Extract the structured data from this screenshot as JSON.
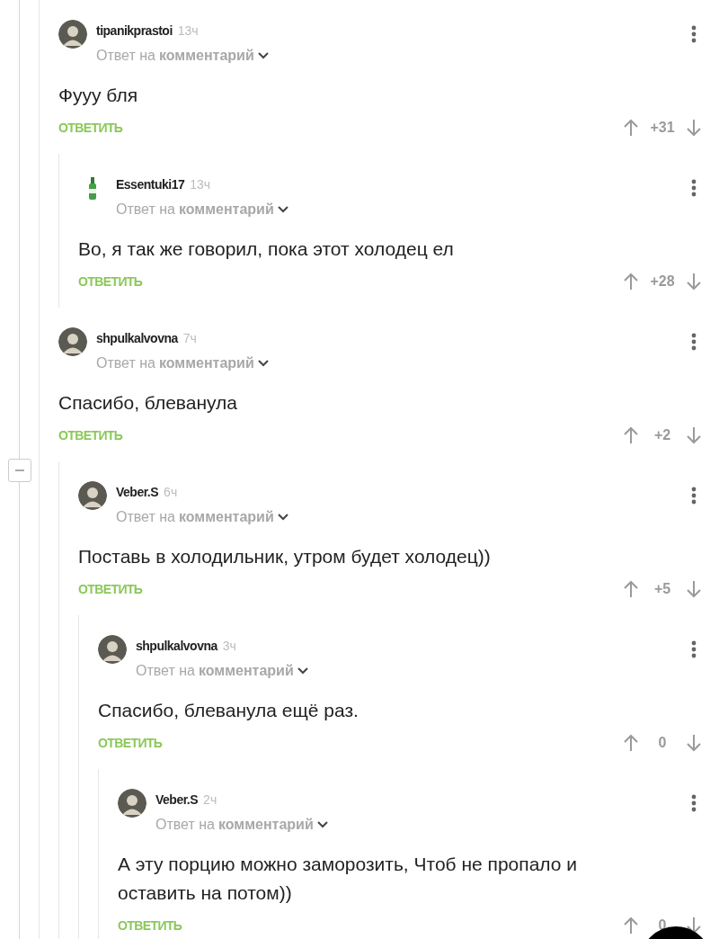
{
  "comments": [
    {
      "author": "tipanikprastoi",
      "time": "13ч",
      "avatar": {
        "kind": "photo"
      },
      "reply_to_prefix": "Ответ на",
      "reply_to": "комментарий",
      "text": "Фууу бля",
      "reply_label": "ОТВЕТИТЬ",
      "score": "+31",
      "children": [
        {
          "author": "Essentuki17",
          "time": "13ч",
          "avatar": {
            "kind": "bottle"
          },
          "reply_to_prefix": "Ответ на",
          "reply_to": "комментарий",
          "text": "Во, я так же говорил, пока этот холодец ел",
          "reply_label": "ОТВЕТИТЬ",
          "score": "+28"
        }
      ]
    },
    {
      "author": "shpulkalvovna",
      "time": "7ч",
      "avatar": {
        "kind": "photo"
      },
      "reply_to_prefix": "Ответ на",
      "reply_to": "комментарий",
      "text": "Спасибо, блеванула",
      "reply_label": "ОТВЕТИТЬ",
      "score": "+2",
      "expanded": true,
      "children": [
        {
          "author": "Veber.S",
          "time": "6ч",
          "avatar": {
            "kind": "photo"
          },
          "reply_to_prefix": "Ответ на",
          "reply_to": "комментарий",
          "text": "Поставь в холодильник, утром будет холодец))",
          "reply_label": "ОТВЕТИТЬ",
          "score": "+5",
          "children": [
            {
              "author": "shpulkalvovna",
              "time": "3ч",
              "avatar": {
                "kind": "photo"
              },
              "reply_to_prefix": "Ответ на",
              "reply_to": "комментарий",
              "text": "Спасибо, блеванула ещё раз.",
              "reply_label": "ОТВЕТИТЬ",
              "score": "0",
              "children": [
                {
                  "author": "Veber.S",
                  "time": "2ч",
                  "avatar": {
                    "kind": "photo"
                  },
                  "reply_to_prefix": "Ответ на",
                  "reply_to": "комментарий",
                  "text": "А эту порцию можно заморозить, Чтоб не пропало и оставить на потом))",
                  "reply_label": "ОТВЕТИТЬ",
                  "score": "0"
                }
              ]
            }
          ]
        }
      ]
    }
  ]
}
